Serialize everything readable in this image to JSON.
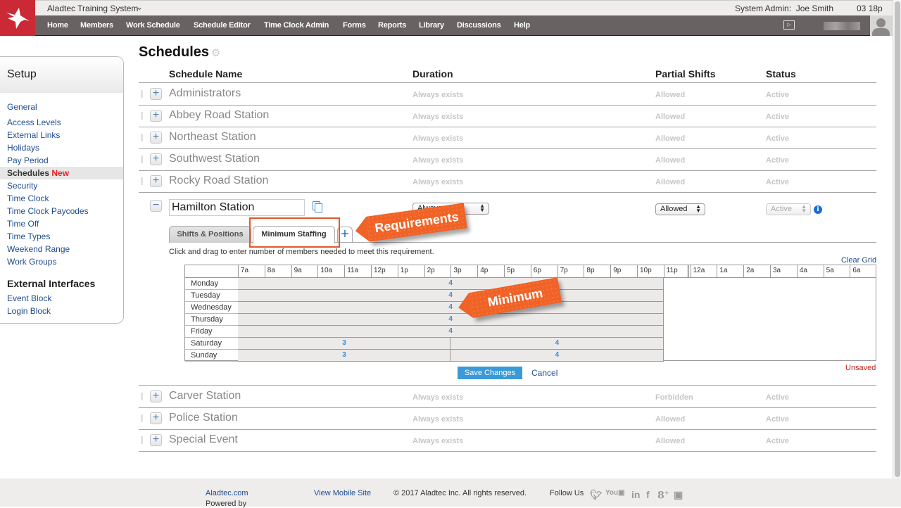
{
  "app": {
    "system_name": "Aladtec Training System",
    "user_role_label": "System Admin:",
    "user_name": "Joe Smith",
    "clock": "03 18p"
  },
  "nav": {
    "items": [
      "Home",
      "Members",
      "Work Schedule",
      "Schedule Editor",
      "Time Clock Admin",
      "Forms",
      "Reports",
      "Library",
      "Discussions",
      "Help"
    ]
  },
  "sidebar": {
    "title": "Setup",
    "items": [
      "General",
      "Access Levels",
      "External Links",
      "Holidays",
      "Pay Period",
      "Schedules",
      "Security",
      "Time Clock",
      "Time Clock Paycodes",
      "Time Off",
      "Time Types",
      "Weekend Range",
      "Work Groups"
    ],
    "active_badge": "New",
    "section2_title": "External Interfaces",
    "section2_items": [
      "Event Block",
      "Login Block"
    ]
  },
  "page": {
    "title": "Schedules",
    "columns": [
      "Schedule Name",
      "Duration",
      "Partial Shifts",
      "Status"
    ]
  },
  "schedules_top": [
    {
      "name": "Administrators",
      "duration": "Always exists",
      "partial": "Allowed",
      "status": "Active"
    },
    {
      "name": "Abbey Road Station",
      "duration": "Always exists",
      "partial": "Allowed",
      "status": "Active"
    },
    {
      "name": "Northeast Station",
      "duration": "Always exists",
      "partial": "Allowed",
      "status": "Active"
    },
    {
      "name": "Southwest Station",
      "duration": "Always exists",
      "partial": "Allowed",
      "status": "Active"
    },
    {
      "name": "Rocky Road Station",
      "duration": "Always exists",
      "partial": "Allowed",
      "status": "Active"
    }
  ],
  "editing": {
    "name_value": "Hamilton Station",
    "duration_value": "Always exists",
    "partial_value": "Allowed",
    "status_value": "Active",
    "tabs": [
      "Shifts & Positions",
      "Minimum Staffing"
    ],
    "active_tab": "Minimum Staffing",
    "instruction": "Click and drag to enter number of members needed to meet this requirement.",
    "clear_grid": "Clear Grid",
    "save_label": "Save Changes",
    "cancel_label": "Cancel",
    "unsaved_label": "Unsaved"
  },
  "staffing_grid": {
    "hours": [
      "7a",
      "8a",
      "9a",
      "10a",
      "11a",
      "12p",
      "1p",
      "2p",
      "3p",
      "4p",
      "5p",
      "6p",
      "7p",
      "8p",
      "9p",
      "10p",
      "11p",
      "12a",
      "1a",
      "2a",
      "3a",
      "4a",
      "5a",
      "6a"
    ],
    "days": [
      "Monday",
      "Tuesday",
      "Wednesday",
      "Thursday",
      "Friday",
      "Saturday",
      "Sunday"
    ],
    "requirements": [
      {
        "day": "Monday",
        "start": "7a",
        "end": "11p",
        "minimum": "4"
      },
      {
        "day": "Tuesday",
        "start": "7a",
        "end": "11p",
        "minimum": "4"
      },
      {
        "day": "Wednesday",
        "start": "7a",
        "end": "11p",
        "minimum": "4"
      },
      {
        "day": "Thursday",
        "start": "7a",
        "end": "11p",
        "minimum": "4"
      },
      {
        "day": "Friday",
        "start": "7a",
        "end": "11p",
        "minimum": "4"
      },
      {
        "day": "Saturday",
        "start": "7a",
        "end": "3p",
        "minimum": "3"
      },
      {
        "day": "Saturday",
        "start": "3p",
        "end": "11p",
        "minimum": "4"
      },
      {
        "day": "Sunday",
        "start": "7a",
        "end": "3p",
        "minimum": "3"
      },
      {
        "day": "Sunday",
        "start": "3p",
        "end": "11p",
        "minimum": "4"
      }
    ]
  },
  "callouts": {
    "requirements": "Requirements",
    "minimum": "Minimum"
  },
  "schedules_bottom": [
    {
      "name": "Carver Station",
      "duration": "Always exists",
      "partial": "Forbidden",
      "status": "Active"
    },
    {
      "name": "Police Station",
      "duration": "Always exists",
      "partial": "Allowed",
      "status": "Active"
    },
    {
      "name": "Special Event",
      "duration": "Always exists",
      "partial": "Allowed",
      "status": "Active"
    }
  ],
  "footer": {
    "powered_prefix": "Powered by ",
    "powered_link": "Aladtec.com",
    "mobile_link": "View Mobile Site",
    "copyright": "© 2017 Aladtec Inc. All rights reserved.",
    "follow": "Follow Us",
    "social_icons": [
      "twitter-icon",
      "youtube-icon",
      "linkedin-icon",
      "facebook-icon",
      "google-plus-icon",
      "blogger-icon"
    ]
  }
}
